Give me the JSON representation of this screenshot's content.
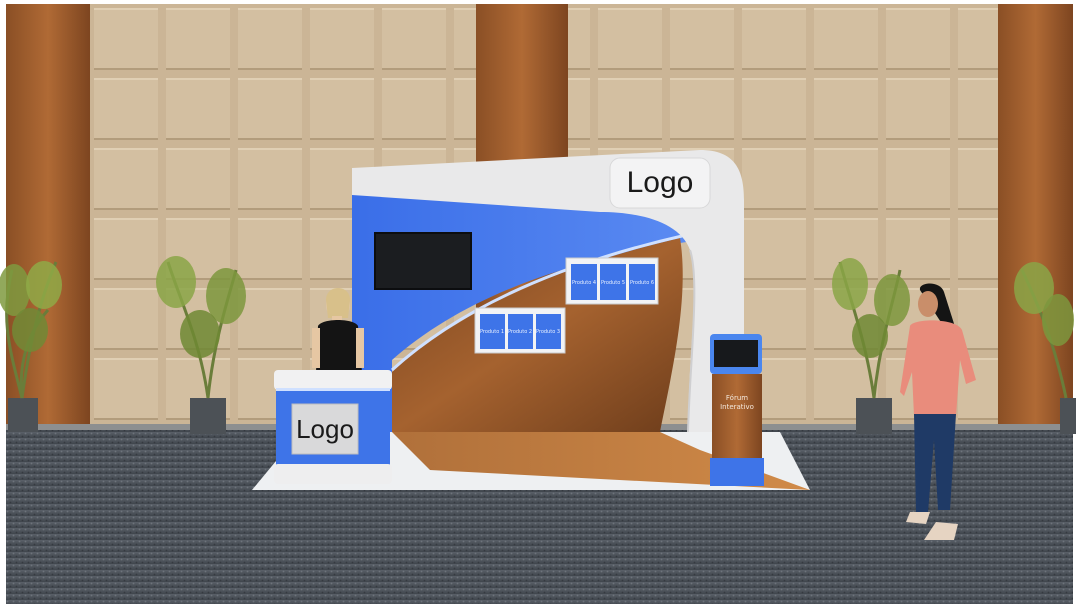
{
  "scene": {
    "booth_logo": "Logo",
    "counter_logo": "Logo",
    "shelf_right": [
      "Produto 4",
      "Produto 5",
      "Produto 6"
    ],
    "shelf_left": [
      "Produto 1",
      "Produto 2",
      "Produto 3"
    ],
    "kiosk_line1": "Fórum",
    "kiosk_line2": "Interativo",
    "colors": {
      "accent_blue": "#3e74e8",
      "wall_panel": "#cdb89a",
      "wood": "#9a5a2a",
      "carpet": "#4b5158",
      "booth_white": "#e9e9ea"
    }
  }
}
